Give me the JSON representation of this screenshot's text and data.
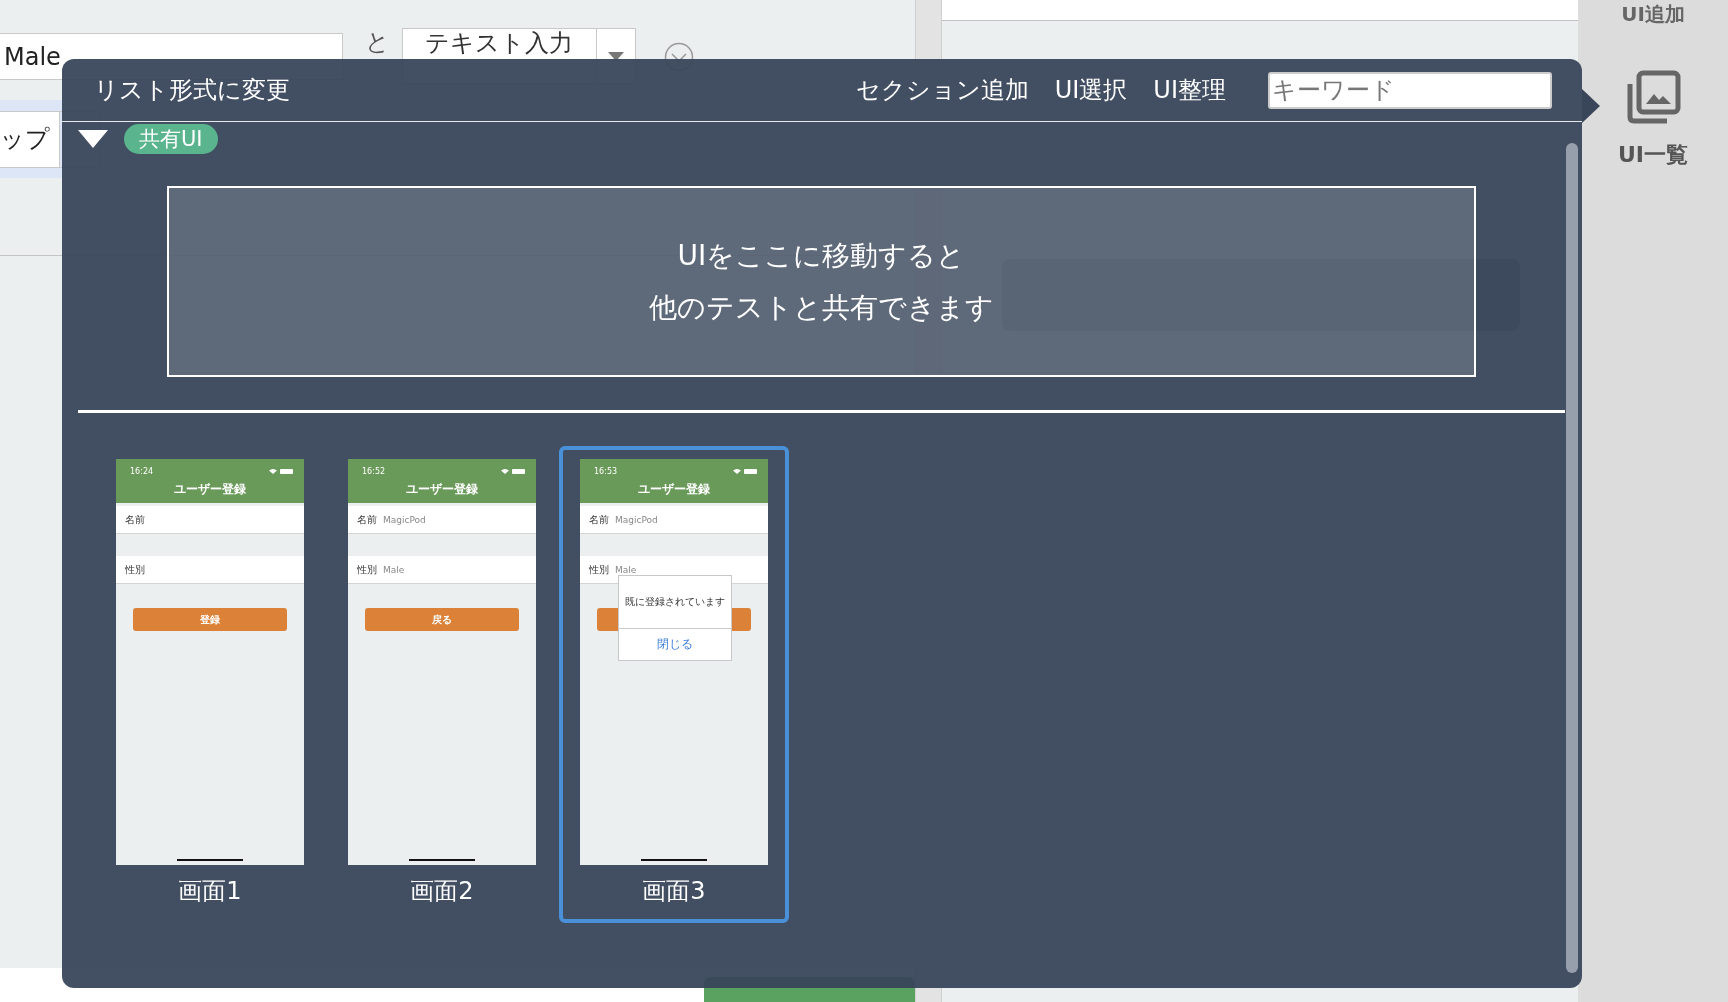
{
  "background": {
    "name_field_value": "Male",
    "connector": "と",
    "type_dropdown": "テキスト入力",
    "left_field_value": "ップ"
  },
  "sidebar": {
    "add_label": "UI追加",
    "list_label": "UI一覧"
  },
  "popover": {
    "title": "リスト形式に変更",
    "actions": [
      "セクション追加",
      "UI選択",
      "UI整理"
    ],
    "search": {
      "placeholder": "キーワード"
    },
    "section": {
      "expanded": true,
      "badge": "共有UI"
    },
    "dropzone": [
      "UIをここに移動すると",
      "他のテストと共有できます"
    ],
    "screens": [
      {
        "label": "画面1",
        "selected": false,
        "time": "16:24",
        "title": "ユーザー登録",
        "fields": [
          {
            "label": "名前"
          },
          {
            "label": "性別"
          }
        ],
        "button": "登録"
      },
      {
        "label": "画面2",
        "selected": false,
        "time": "16:52",
        "title": "ユーザー登録",
        "fields": [
          {
            "label": "名前",
            "value": "MagicPod"
          },
          {
            "label": "性別",
            "value": "Male"
          }
        ],
        "button": "戻る"
      },
      {
        "label": "画面3",
        "selected": true,
        "time": "16:53",
        "title": "ユーザー登録",
        "fields": [
          {
            "label": "名前",
            "value": "MagicPod"
          },
          {
            "label": "性別",
            "value": "Male"
          }
        ],
        "dialog": {
          "message": "既に登録されています",
          "action": "閉じる"
        }
      }
    ]
  }
}
